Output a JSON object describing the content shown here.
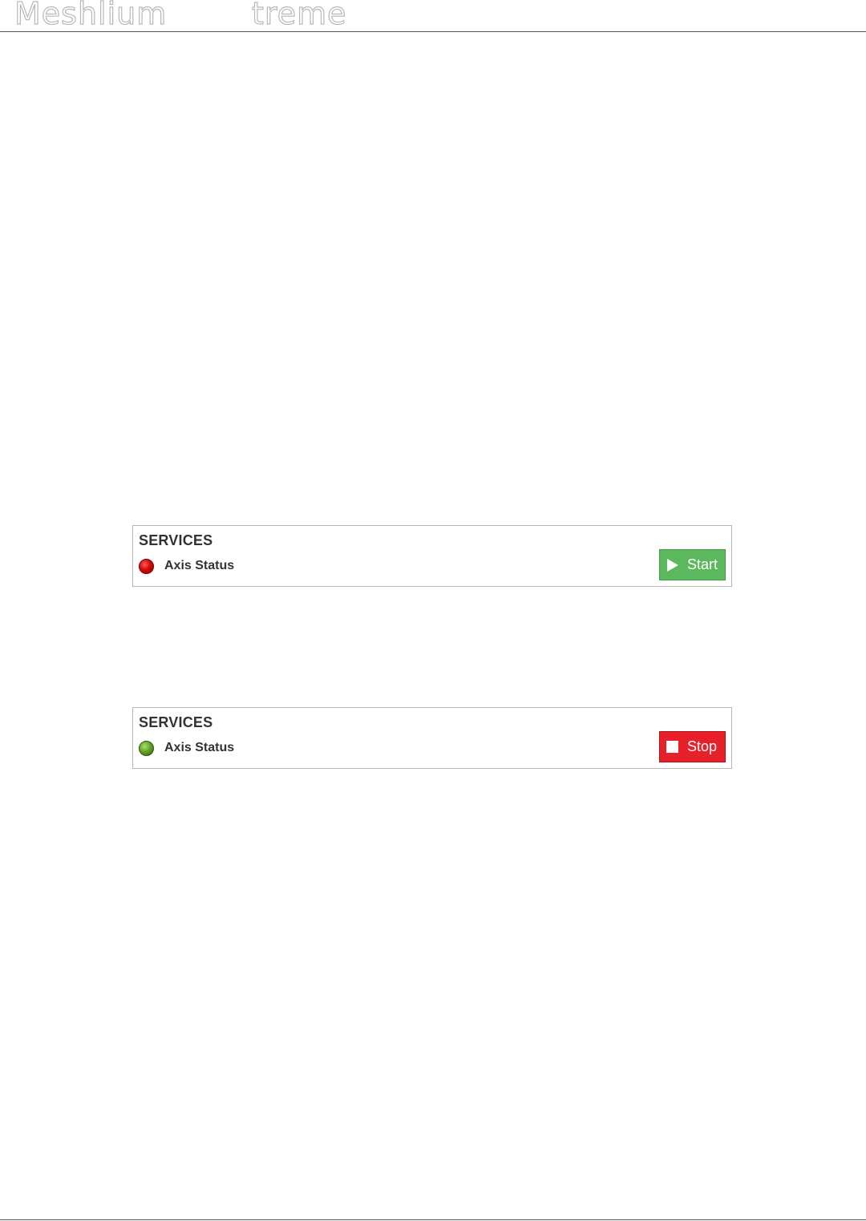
{
  "header": {
    "brand_left": "Meshlium",
    "brand_right": "treme"
  },
  "panels": [
    {
      "title": "SERVICES",
      "service_label": "Axis Status",
      "status": "stopped",
      "status_color": "#d10a0a",
      "button": {
        "label": "Start",
        "icon": "play-icon",
        "color": "#5cb85c"
      }
    },
    {
      "title": "SERVICES",
      "service_label": "Axis Status",
      "status": "running",
      "status_color": "#5c9f22",
      "button": {
        "label": "Stop",
        "icon": "stop-icon",
        "color": "#e8202a"
      }
    }
  ]
}
